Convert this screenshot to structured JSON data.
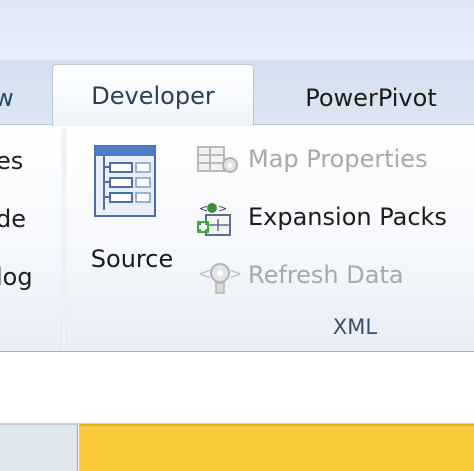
{
  "tabs": {
    "prev_partial": "w",
    "active": "Developer",
    "next": "PowerPivot"
  },
  "left_group_partial": {
    "line1": "es",
    "line2": "de",
    "line3": "log"
  },
  "xml_group": {
    "label": "XML",
    "source_label": "Source",
    "commands": [
      {
        "label": "Map Properties",
        "icon": "map-properties-icon",
        "enabled": false
      },
      {
        "label": "Expansion Packs",
        "icon": "expansion-packs-icon",
        "enabled": true
      },
      {
        "label": "Refresh Data",
        "icon": "refresh-data-icon",
        "enabled": false
      }
    ]
  },
  "colors": {
    "active_cell_fill": "#f8c93b",
    "disabled_text": "#a8a8a8",
    "tab_text": "#1e395b"
  }
}
